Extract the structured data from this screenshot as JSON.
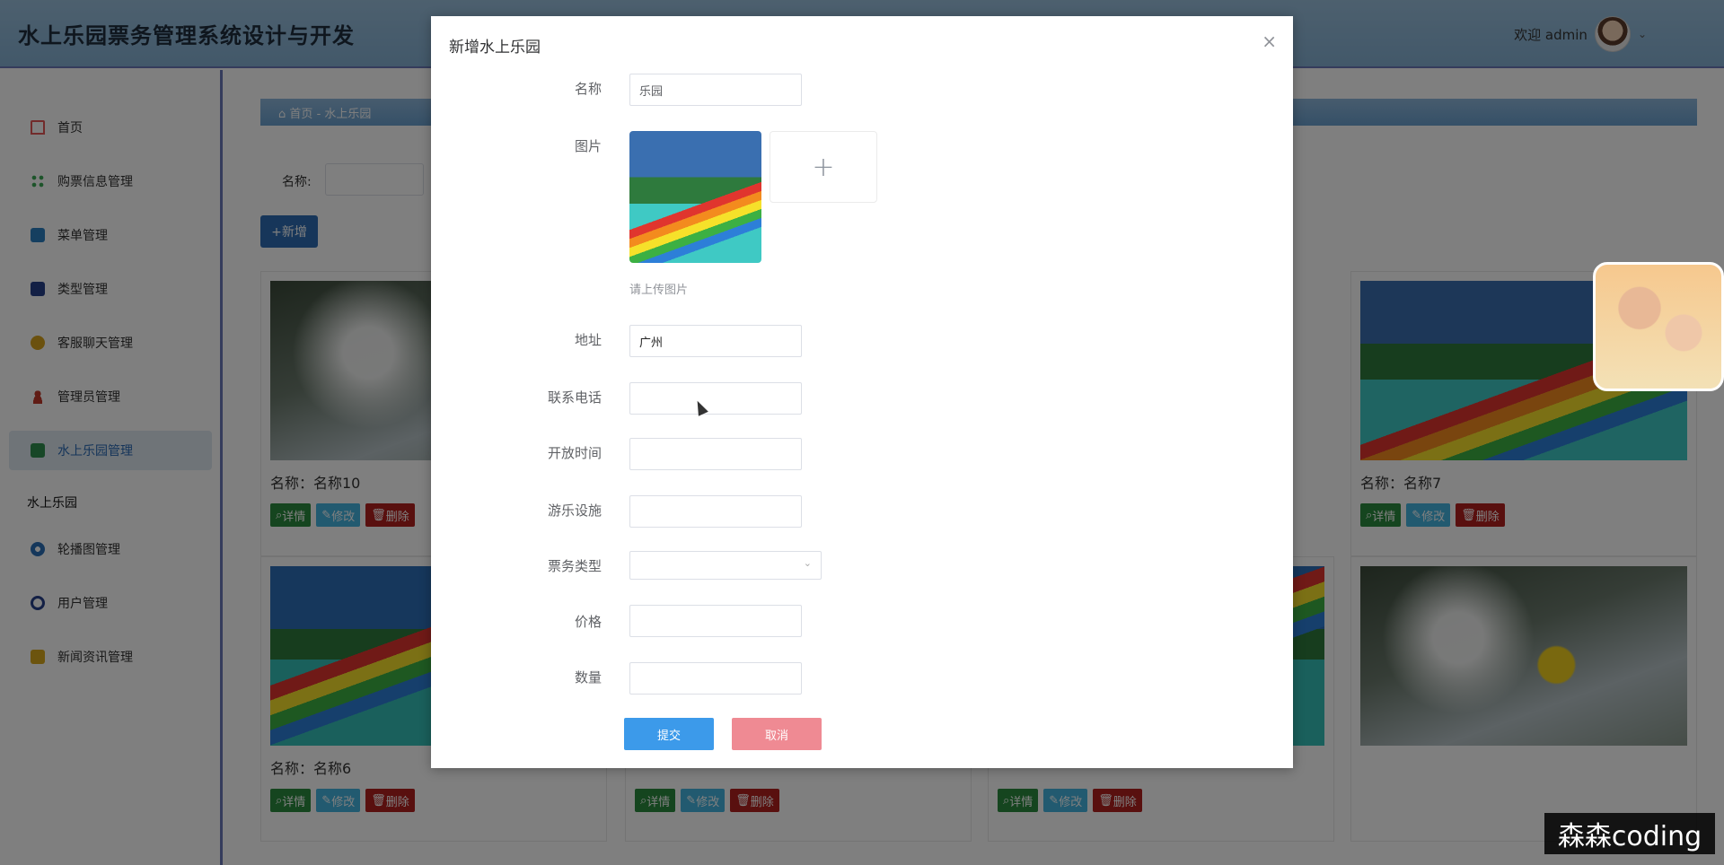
{
  "app": {
    "title": "水上乐园票务管理系统设计与开发"
  },
  "user": {
    "greeting": "欢迎 admin"
  },
  "sidebar": {
    "items": [
      {
        "label": "首页",
        "icon": "home-icon"
      },
      {
        "label": "购票信息管理",
        "icon": "grid-icon"
      },
      {
        "label": "菜单管理",
        "icon": "menu-icon"
      },
      {
        "label": "类型管理",
        "icon": "table-icon"
      },
      {
        "label": "客服聊天管理",
        "icon": "chat-icon"
      },
      {
        "label": "管理员管理",
        "icon": "user-icon"
      },
      {
        "label": "水上乐园管理",
        "icon": "folder-icon"
      }
    ],
    "group_label": "水上乐园",
    "group_items": [
      {
        "label": "轮播图管理",
        "icon": "carousel-icon"
      },
      {
        "label": "用户管理",
        "icon": "users-icon"
      },
      {
        "label": "新闻资讯管理",
        "icon": "news-icon"
      }
    ]
  },
  "breadcrumb": {
    "home": "首页",
    "sep": "-",
    "current": "水上乐园"
  },
  "search": {
    "label": "名称:"
  },
  "toolbar": {
    "add_label": "+新增"
  },
  "cards": [
    {
      "name": "名称：名称10"
    },
    {
      "name": "名称：名称7"
    },
    {
      "name": "名称：名称6"
    }
  ],
  "card_buttons": {
    "detail": "详情",
    "edit": "修改",
    "delete": "删除"
  },
  "dialog": {
    "title": "新增水上乐园",
    "close": "×",
    "fields": {
      "name": {
        "label": "名称",
        "placeholder": "乐园"
      },
      "image": {
        "label": "图片",
        "hint": "请上传图片",
        "add": "+"
      },
      "address": {
        "label": "地址",
        "value": "广州"
      },
      "phone": {
        "label": "联系电话",
        "value": ""
      },
      "open_time": {
        "label": "开放时间",
        "value": ""
      },
      "facilities": {
        "label": "游乐设施",
        "value": ""
      },
      "ticket_type": {
        "label": "票务类型",
        "value": ""
      },
      "price": {
        "label": "价格",
        "value": ""
      },
      "quantity": {
        "label": "数量",
        "value": ""
      }
    },
    "submit": "提交",
    "cancel": "取消"
  },
  "watermark": "森森coding",
  "colors": {
    "header_bg": "#8fb7d8",
    "sidebar_active_bg": "#dfe8f1",
    "submit": "#3c9aea",
    "cancel": "#ef8a93",
    "detail": "#2b8a3e",
    "edit": "#44b5e0",
    "delete": "#b3201f"
  }
}
